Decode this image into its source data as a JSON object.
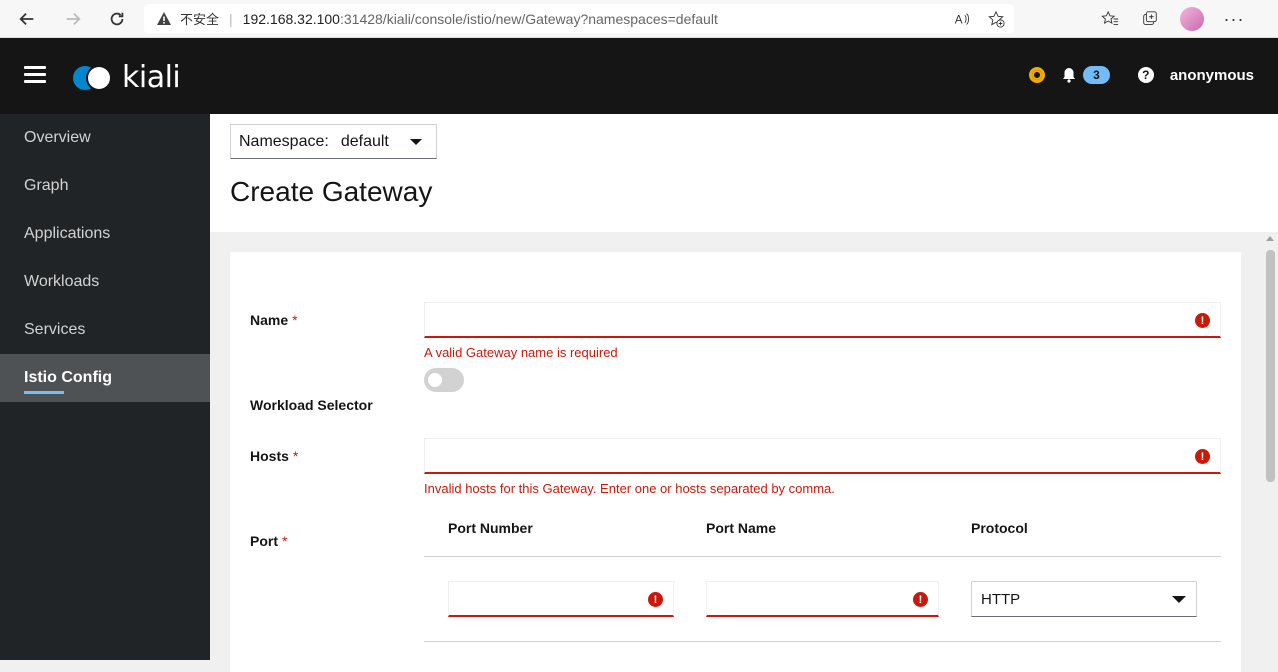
{
  "browser": {
    "insecure_label": "不安全",
    "url_host": "192.168.32.100",
    "url_rest": ":31428/kiali/console/istio/new/Gateway?namespaces=default"
  },
  "masthead": {
    "logo_text": "kiali",
    "notification_count": "3",
    "username": "anonymous",
    "status_color": "#f0ab00"
  },
  "sidebar": {
    "items": [
      {
        "label": "Overview"
      },
      {
        "label": "Graph"
      },
      {
        "label": "Applications"
      },
      {
        "label": "Workloads"
      },
      {
        "label": "Services"
      },
      {
        "label": "Istio Config"
      }
    ]
  },
  "header": {
    "namespace_label": "Namespace:",
    "namespace_value": "default",
    "title": "Create Gateway"
  },
  "form": {
    "name_label": "Name",
    "name_required": "*",
    "name_error": "A valid Gateway name is required",
    "workload_selector_label": "Workload Selector",
    "hosts_label": "Hosts",
    "hosts_required": "*",
    "hosts_error": "Invalid hosts for this Gateway. Enter one or hosts separated by comma.",
    "port_label": "Port",
    "port_required": "*",
    "port_columns": [
      "Port Number",
      "Port Name",
      "Protocol"
    ],
    "protocol_value": "HTTP",
    "error_glyph": "!"
  }
}
